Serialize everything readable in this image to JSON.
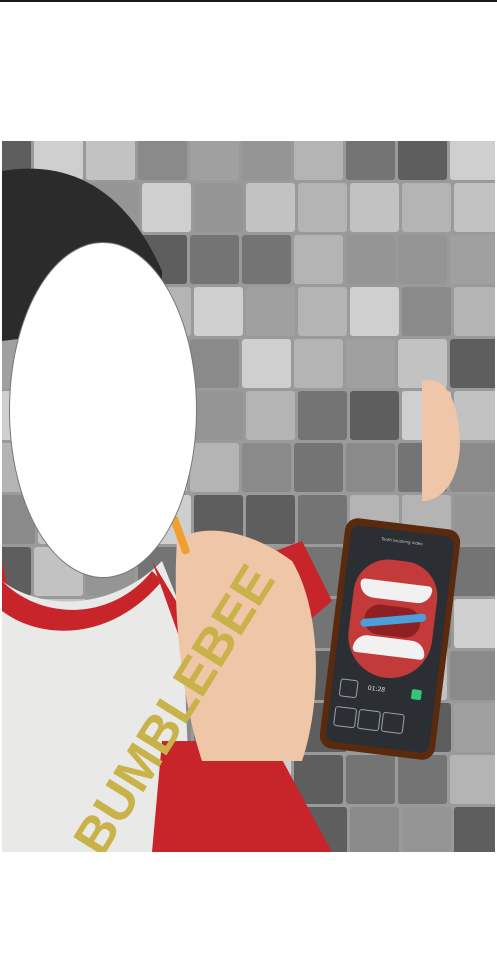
{
  "photo": {
    "shirt_print": "BUMBLEBEE",
    "phone_app": {
      "title": "Tooth brushing video",
      "timer": "01:28"
    }
  },
  "colors": {
    "shirt_red": "#c8252b",
    "shirt_white": "#e9e9e7",
    "print_yellow": "#c9b24a",
    "phone_case": "#5a2a0e",
    "toothbrush": "#f0a030",
    "tile_dark": "#6c6c6c",
    "tile_light": "#cfcfcf"
  }
}
